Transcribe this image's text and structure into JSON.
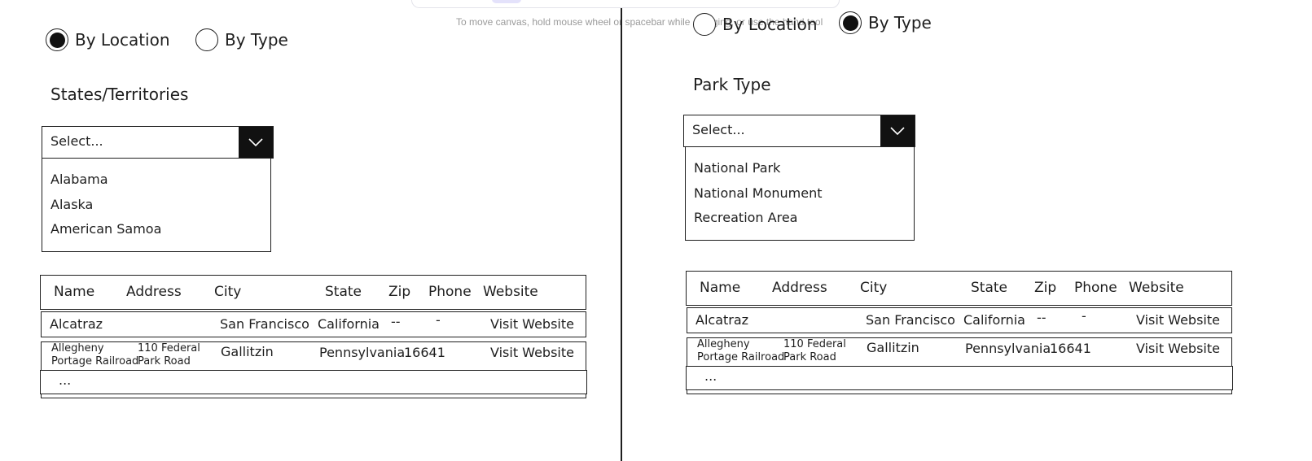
{
  "canvas_hint": "To move canvas, hold mouse wheel or spacebar while dragging, or use the hand tool",
  "left_panel": {
    "radio_location": "By Location",
    "radio_type": "By Type",
    "selected": "location",
    "heading": "States/Territories",
    "select_placeholder": "Select...",
    "options": [
      "Alabama",
      "Alaska",
      "American Samoa"
    ]
  },
  "right_panel": {
    "radio_location": "By Location",
    "radio_type": "By Type",
    "selected": "type",
    "heading": "Park Type",
    "select_placeholder": "Select...",
    "options": [
      "National Park",
      "National Monument",
      "Recreation Area"
    ]
  },
  "table": {
    "headers": [
      "Name",
      "Address",
      "City",
      "State",
      "Zip",
      "Phone",
      "Website"
    ],
    "rows": [
      {
        "name": "Alcatraz",
        "name2": "",
        "address": "",
        "address2": "",
        "city": "San Francisco",
        "state": "California",
        "zip": "--",
        "phone": "-",
        "website": "Visit Website"
      },
      {
        "name": "Allegheny",
        "name2": "Portage Railroad",
        "address": "110 Federal",
        "address2": "Park Road",
        "city": "Gallitzin",
        "state": "Pennsylvania",
        "zip": "16641",
        "phone": "",
        "website": "Visit Website"
      }
    ],
    "more": "..."
  }
}
